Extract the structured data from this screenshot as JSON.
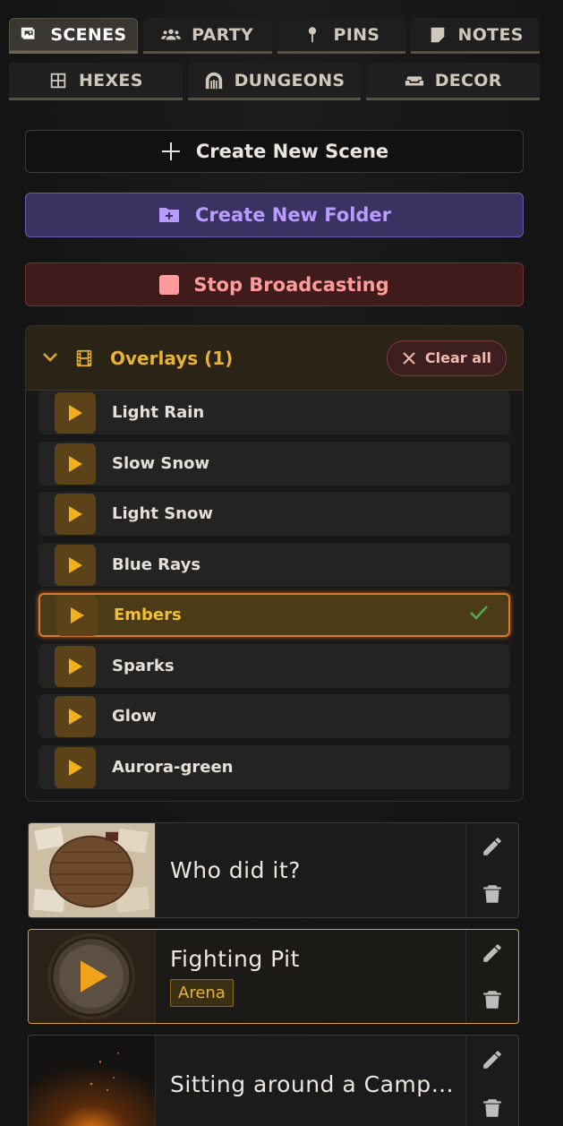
{
  "tabs_primary": [
    {
      "label": "SCENES",
      "icon": "image-icon",
      "active": true
    },
    {
      "label": "PARTY",
      "icon": "users-icon",
      "active": false
    },
    {
      "label": "PINS",
      "icon": "pin-icon",
      "active": false
    },
    {
      "label": "NOTES",
      "icon": "note-icon",
      "active": false
    }
  ],
  "tabs_secondary": [
    {
      "label": "HEXES",
      "icon": "grid-icon"
    },
    {
      "label": "DUNGEONS",
      "icon": "dungeon-icon"
    },
    {
      "label": "DECOR",
      "icon": "sofa-icon"
    }
  ],
  "actions": {
    "create_scene": "Create New Scene",
    "create_folder": "Create New Folder",
    "stop_broadcasting": "Stop Broadcasting"
  },
  "overlays": {
    "title": "Overlays (1)",
    "clear_label": "Clear all",
    "items": [
      {
        "name": "Light Rain",
        "selected": false
      },
      {
        "name": "Slow Snow",
        "selected": false
      },
      {
        "name": "Light Snow",
        "selected": false
      },
      {
        "name": "Blue Rays",
        "selected": false
      },
      {
        "name": "Embers",
        "selected": true
      },
      {
        "name": "Sparks",
        "selected": false
      },
      {
        "name": "Glow",
        "selected": false
      },
      {
        "name": "Aurora-green",
        "selected": false
      }
    ]
  },
  "scenes": [
    {
      "title": "Who did it?",
      "tag": ""
    },
    {
      "title": "Fighting Pit",
      "tag": "Arena"
    },
    {
      "title": "Sitting around a Camp…",
      "tag": ""
    }
  ],
  "colors": {
    "accent": "#e8b437",
    "folder": "#b99cff",
    "stop": "#ff9b9b",
    "selected_border": "#d9792d",
    "check": "#4caf50"
  }
}
